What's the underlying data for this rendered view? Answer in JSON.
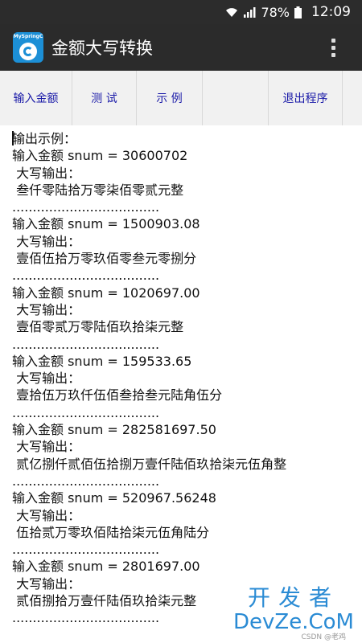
{
  "status": {
    "battery": "78%",
    "time": "12:09"
  },
  "app": {
    "title": "金额大写转换",
    "icon_label": "MySpringC"
  },
  "toolbar": {
    "btn_input": "输入金额",
    "btn_test": "测 试",
    "btn_example": "示 例",
    "btn_empty": "",
    "btn_exit": "退出程序"
  },
  "output": {
    "header": "输出示例：",
    "separator": "....................................",
    "label_upper": " 大写输出：",
    "examples": [
      {
        "input": "输入金额 snum = 30600702",
        "result": " 叁仟零陆拾万零柒佰零贰元整"
      },
      {
        "input": "输入金额 snum = 1500903.08",
        "result": " 壹佰伍拾万零玖佰零叁元零捌分"
      },
      {
        "input": "输入金额 snum = 1020697.00",
        "result": " 壹佰零贰万零陆佰玖拾柒元整"
      },
      {
        "input": "输入金额 snum = 159533.65",
        "result": " 壹拾伍万玖仟伍佰叁拾叁元陆角伍分"
      },
      {
        "input": "输入金额 snum = 282581697.50",
        "result": " 贰亿捌仟贰佰伍拾捌万壹仟陆佰玖拾柒元伍角整"
      },
      {
        "input": "输入金额 snum = 520967.56248",
        "result": " 伍拾贰万零玖佰陆拾柒元伍角陆分"
      },
      {
        "input": "输入金额 snum = 2801697.00",
        "result": " 贰佰捌拾万壹仟陆佰玖拾柒元整"
      }
    ]
  },
  "watermark": {
    "cn": "开发者",
    "en": "DevZe.CoM",
    "small": "CSDN @老鸡"
  },
  "colors": {
    "status_bar": "#2c2c2c",
    "action_bar": "#2b2b2b",
    "toolbar_text": "#1a1aa8",
    "watermark": "#2a8bd4"
  }
}
